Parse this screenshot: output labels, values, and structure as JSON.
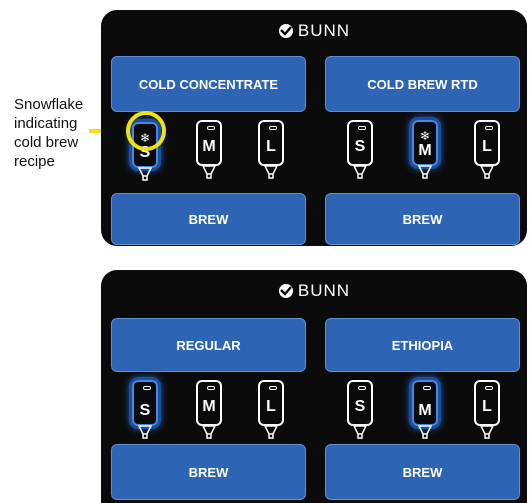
{
  "annotation": {
    "lines": [
      "Snowflake",
      "indicating",
      "cold brew",
      "recipe"
    ]
  },
  "brand": {
    "name": "BUNN"
  },
  "colors": {
    "accent": "#2d64b3",
    "highlight": "#f2e20c",
    "panel": "#0b0b0b"
  },
  "panels": [
    {
      "left": {
        "recipe_label": "COLD CONCENTRATE",
        "sizes": [
          {
            "letter": "S",
            "selected": true,
            "snowflake": true
          },
          {
            "letter": "M",
            "selected": false,
            "snowflake": false
          },
          {
            "letter": "L",
            "selected": false,
            "snowflake": false
          }
        ],
        "brew_label": "BREW"
      },
      "right": {
        "recipe_label": "COLD BREW RTD",
        "sizes": [
          {
            "letter": "S",
            "selected": false,
            "snowflake": false
          },
          {
            "letter": "M",
            "selected": true,
            "snowflake": true
          },
          {
            "letter": "L",
            "selected": false,
            "snowflake": false
          }
        ],
        "brew_label": "BREW"
      }
    },
    {
      "left": {
        "recipe_label": "REGULAR",
        "sizes": [
          {
            "letter": "S",
            "selected": true,
            "snowflake": false
          },
          {
            "letter": "M",
            "selected": false,
            "snowflake": false
          },
          {
            "letter": "L",
            "selected": false,
            "snowflake": false
          }
        ],
        "brew_label": "BREW"
      },
      "right": {
        "recipe_label": "ETHIOPIA",
        "sizes": [
          {
            "letter": "S",
            "selected": false,
            "snowflake": false
          },
          {
            "letter": "M",
            "selected": true,
            "snowflake": false
          },
          {
            "letter": "L",
            "selected": false,
            "snowflake": false
          }
        ],
        "brew_label": "BREW"
      }
    }
  ]
}
